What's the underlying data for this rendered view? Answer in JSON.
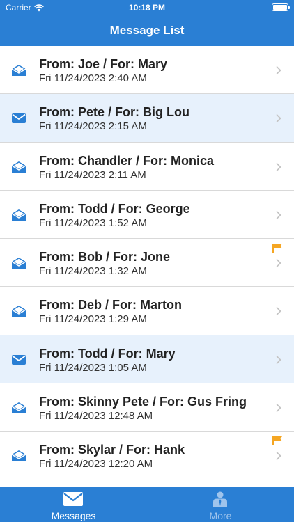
{
  "status_bar": {
    "carrier": "Carrier",
    "time": "10:18 PM"
  },
  "nav": {
    "title": "Message List"
  },
  "messages": [
    {
      "title": "From: Joe / For: Mary",
      "date": "Fri 11/24/2023 2:40 AM",
      "unread": false,
      "flagged": false
    },
    {
      "title": "From: Pete / For: Big Lou",
      "date": "Fri 11/24/2023 2:15 AM",
      "unread": true,
      "flagged": false
    },
    {
      "title": "From: Chandler / For: Monica",
      "date": "Fri 11/24/2023 2:11 AM",
      "unread": false,
      "flagged": false
    },
    {
      "title": "From: Todd / For: George",
      "date": "Fri 11/24/2023 1:52 AM",
      "unread": false,
      "flagged": false
    },
    {
      "title": "From: Bob / For: Jone",
      "date": "Fri 11/24/2023 1:32 AM",
      "unread": false,
      "flagged": true
    },
    {
      "title": "From: Deb / For: Marton",
      "date": "Fri 11/24/2023 1:29 AM",
      "unread": false,
      "flagged": false
    },
    {
      "title": "From: Todd / For: Mary",
      "date": "Fri 11/24/2023 1:05 AM",
      "unread": true,
      "flagged": false
    },
    {
      "title": "From: Skinny Pete / For: Gus Fring",
      "date": "Fri 11/24/2023 12:48 AM",
      "unread": false,
      "flagged": false
    },
    {
      "title": "From: Skylar / For: Hank",
      "date": "Fri 11/24/2023 12:20 AM",
      "unread": false,
      "flagged": true
    }
  ],
  "tabs": [
    {
      "label": "Messages",
      "icon": "envelope-icon",
      "active": true
    },
    {
      "label": "More",
      "icon": "person-icon",
      "active": false
    }
  ],
  "colors": {
    "accent": "#2a7fd4",
    "unread_row": "#e7f1fc",
    "flag": "#f5a623",
    "inactive_tab": "#9fc4ec"
  }
}
